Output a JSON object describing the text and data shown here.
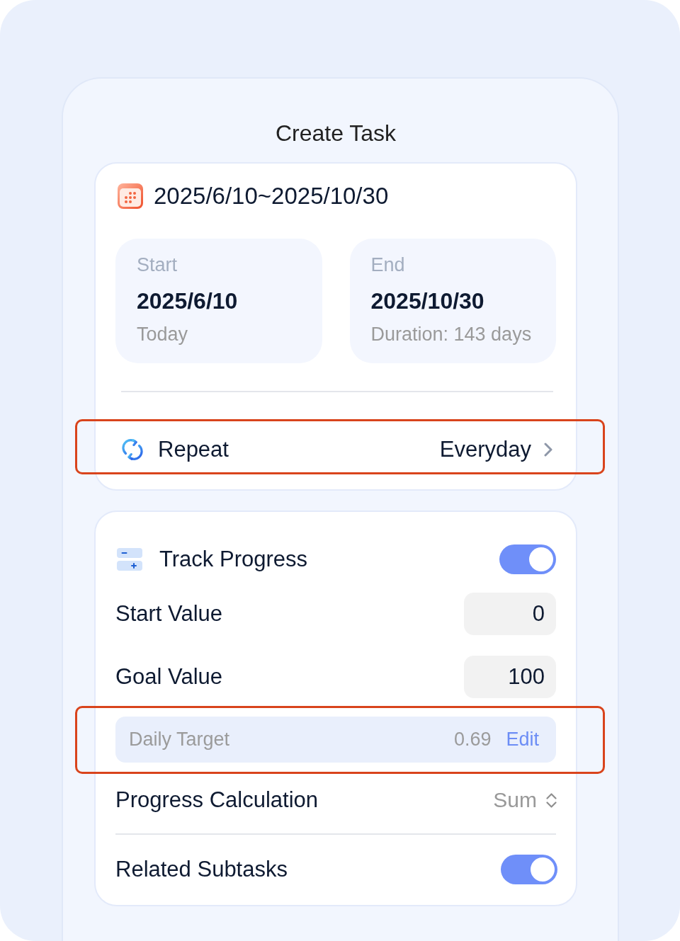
{
  "window": {
    "title": "Create Task"
  },
  "date_range": {
    "text": "2025/6/10~2025/10/30",
    "start": {
      "label": "Start",
      "date": "2025/6/10",
      "note": "Today"
    },
    "end": {
      "label": "End",
      "date": "2025/10/30",
      "note": "Duration: 143 days"
    }
  },
  "repeat": {
    "label": "Repeat",
    "value": "Everyday",
    "highlighted": true
  },
  "progress": {
    "track": {
      "label": "Track Progress",
      "on": true
    },
    "fields": [
      {
        "label": "Start Value",
        "value": "0"
      },
      {
        "label": "Goal Value",
        "value": "100"
      }
    ],
    "daily_target": {
      "label": "Daily Target",
      "value": "0.69",
      "action": "Edit",
      "highlighted": true
    },
    "calculation": {
      "label": "Progress Calculation",
      "value": "Sum"
    },
    "related_subtasks": {
      "label": "Related Subtasks",
      "on": true
    }
  }
}
